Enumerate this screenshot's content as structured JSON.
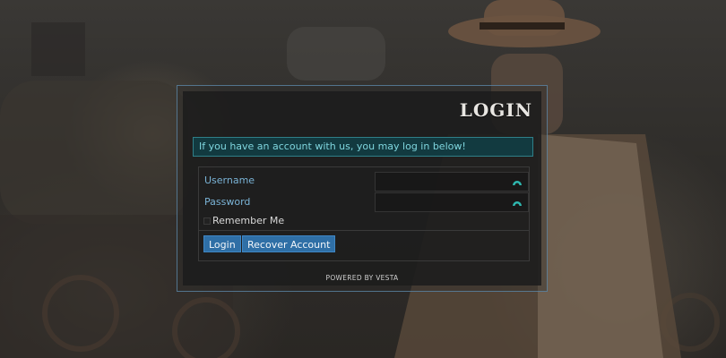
{
  "login": {
    "title": "LOGIN",
    "notice": "If you have an account with us, you may log in below!",
    "username_label": "Username",
    "password_label": "Password",
    "remember_label": "Remember Me",
    "login_button": "Login",
    "recover_button": "Recover Account",
    "powered_by": "POWERED BY VESTA"
  },
  "colors": {
    "accent": "#2f6fa6",
    "notice_bg": "#123a40",
    "notice_text": "#7fd6de",
    "label_text": "#7ab3d6"
  },
  "icons": {
    "username_field": "validation-arc-icon",
    "password_field": "validation-arc-icon"
  }
}
